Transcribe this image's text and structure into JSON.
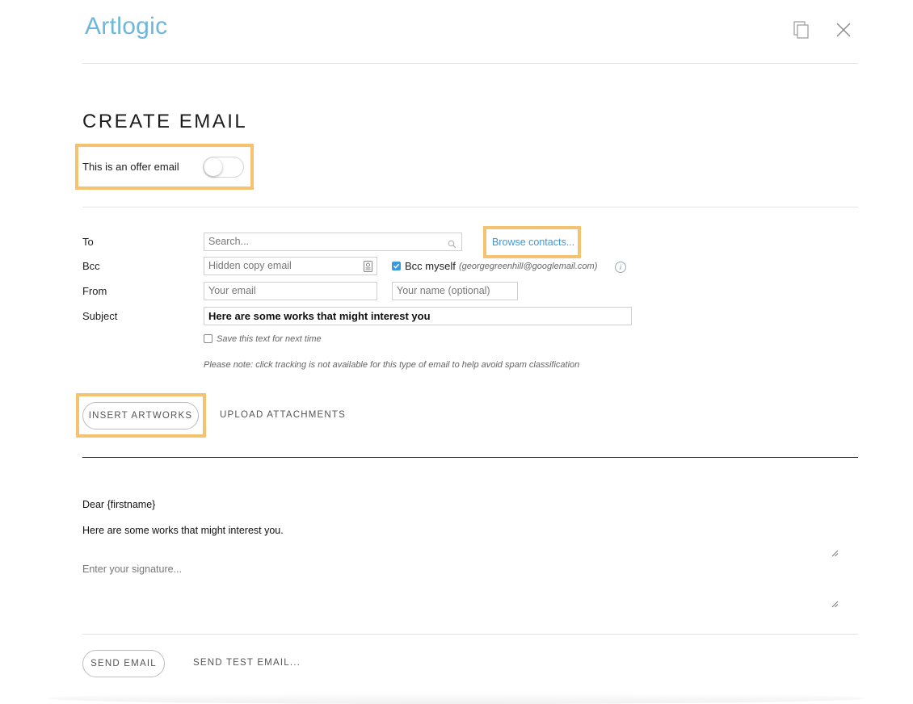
{
  "header": {
    "logo_text": "Artlogic",
    "copy_icon": "copy-icon",
    "close_icon": "close-icon"
  },
  "page": {
    "title": "CREATE EMAIL"
  },
  "offer": {
    "label": "This is an offer email",
    "enabled": false
  },
  "form": {
    "to": {
      "label": "To",
      "placeholder": "Search...",
      "browse_link": "Browse contacts..."
    },
    "bcc": {
      "label": "Bcc",
      "placeholder": "Hidden copy email",
      "myself_label": "Bcc myself",
      "myself_email": "(georgegreenhill@googlemail.com)",
      "myself_checked": true
    },
    "from": {
      "label": "From",
      "email_placeholder": "Your email",
      "name_placeholder": "Your name (optional)"
    },
    "subject": {
      "label": "Subject",
      "value": "Here are some works that might interest you"
    },
    "save_text_label": "Save this text for next time",
    "note": "Please note: click tracking is not available for this type of email to help avoid spam classification"
  },
  "tabs": {
    "insert_artworks": "INSERT ARTWORKS",
    "upload_attachments": "UPLOAD ATTACHMENTS"
  },
  "message": {
    "greeting": "Dear {firstname}",
    "body": "Here are some works that might interest you.",
    "signature_placeholder": "Enter your signature..."
  },
  "footer": {
    "send_email": "SEND EMAIL",
    "send_test_email": "SEND TEST EMAIL..."
  },
  "colors": {
    "highlight": "#f5c26f",
    "link": "#3a9ad9",
    "logo": "#6fb6dc"
  }
}
